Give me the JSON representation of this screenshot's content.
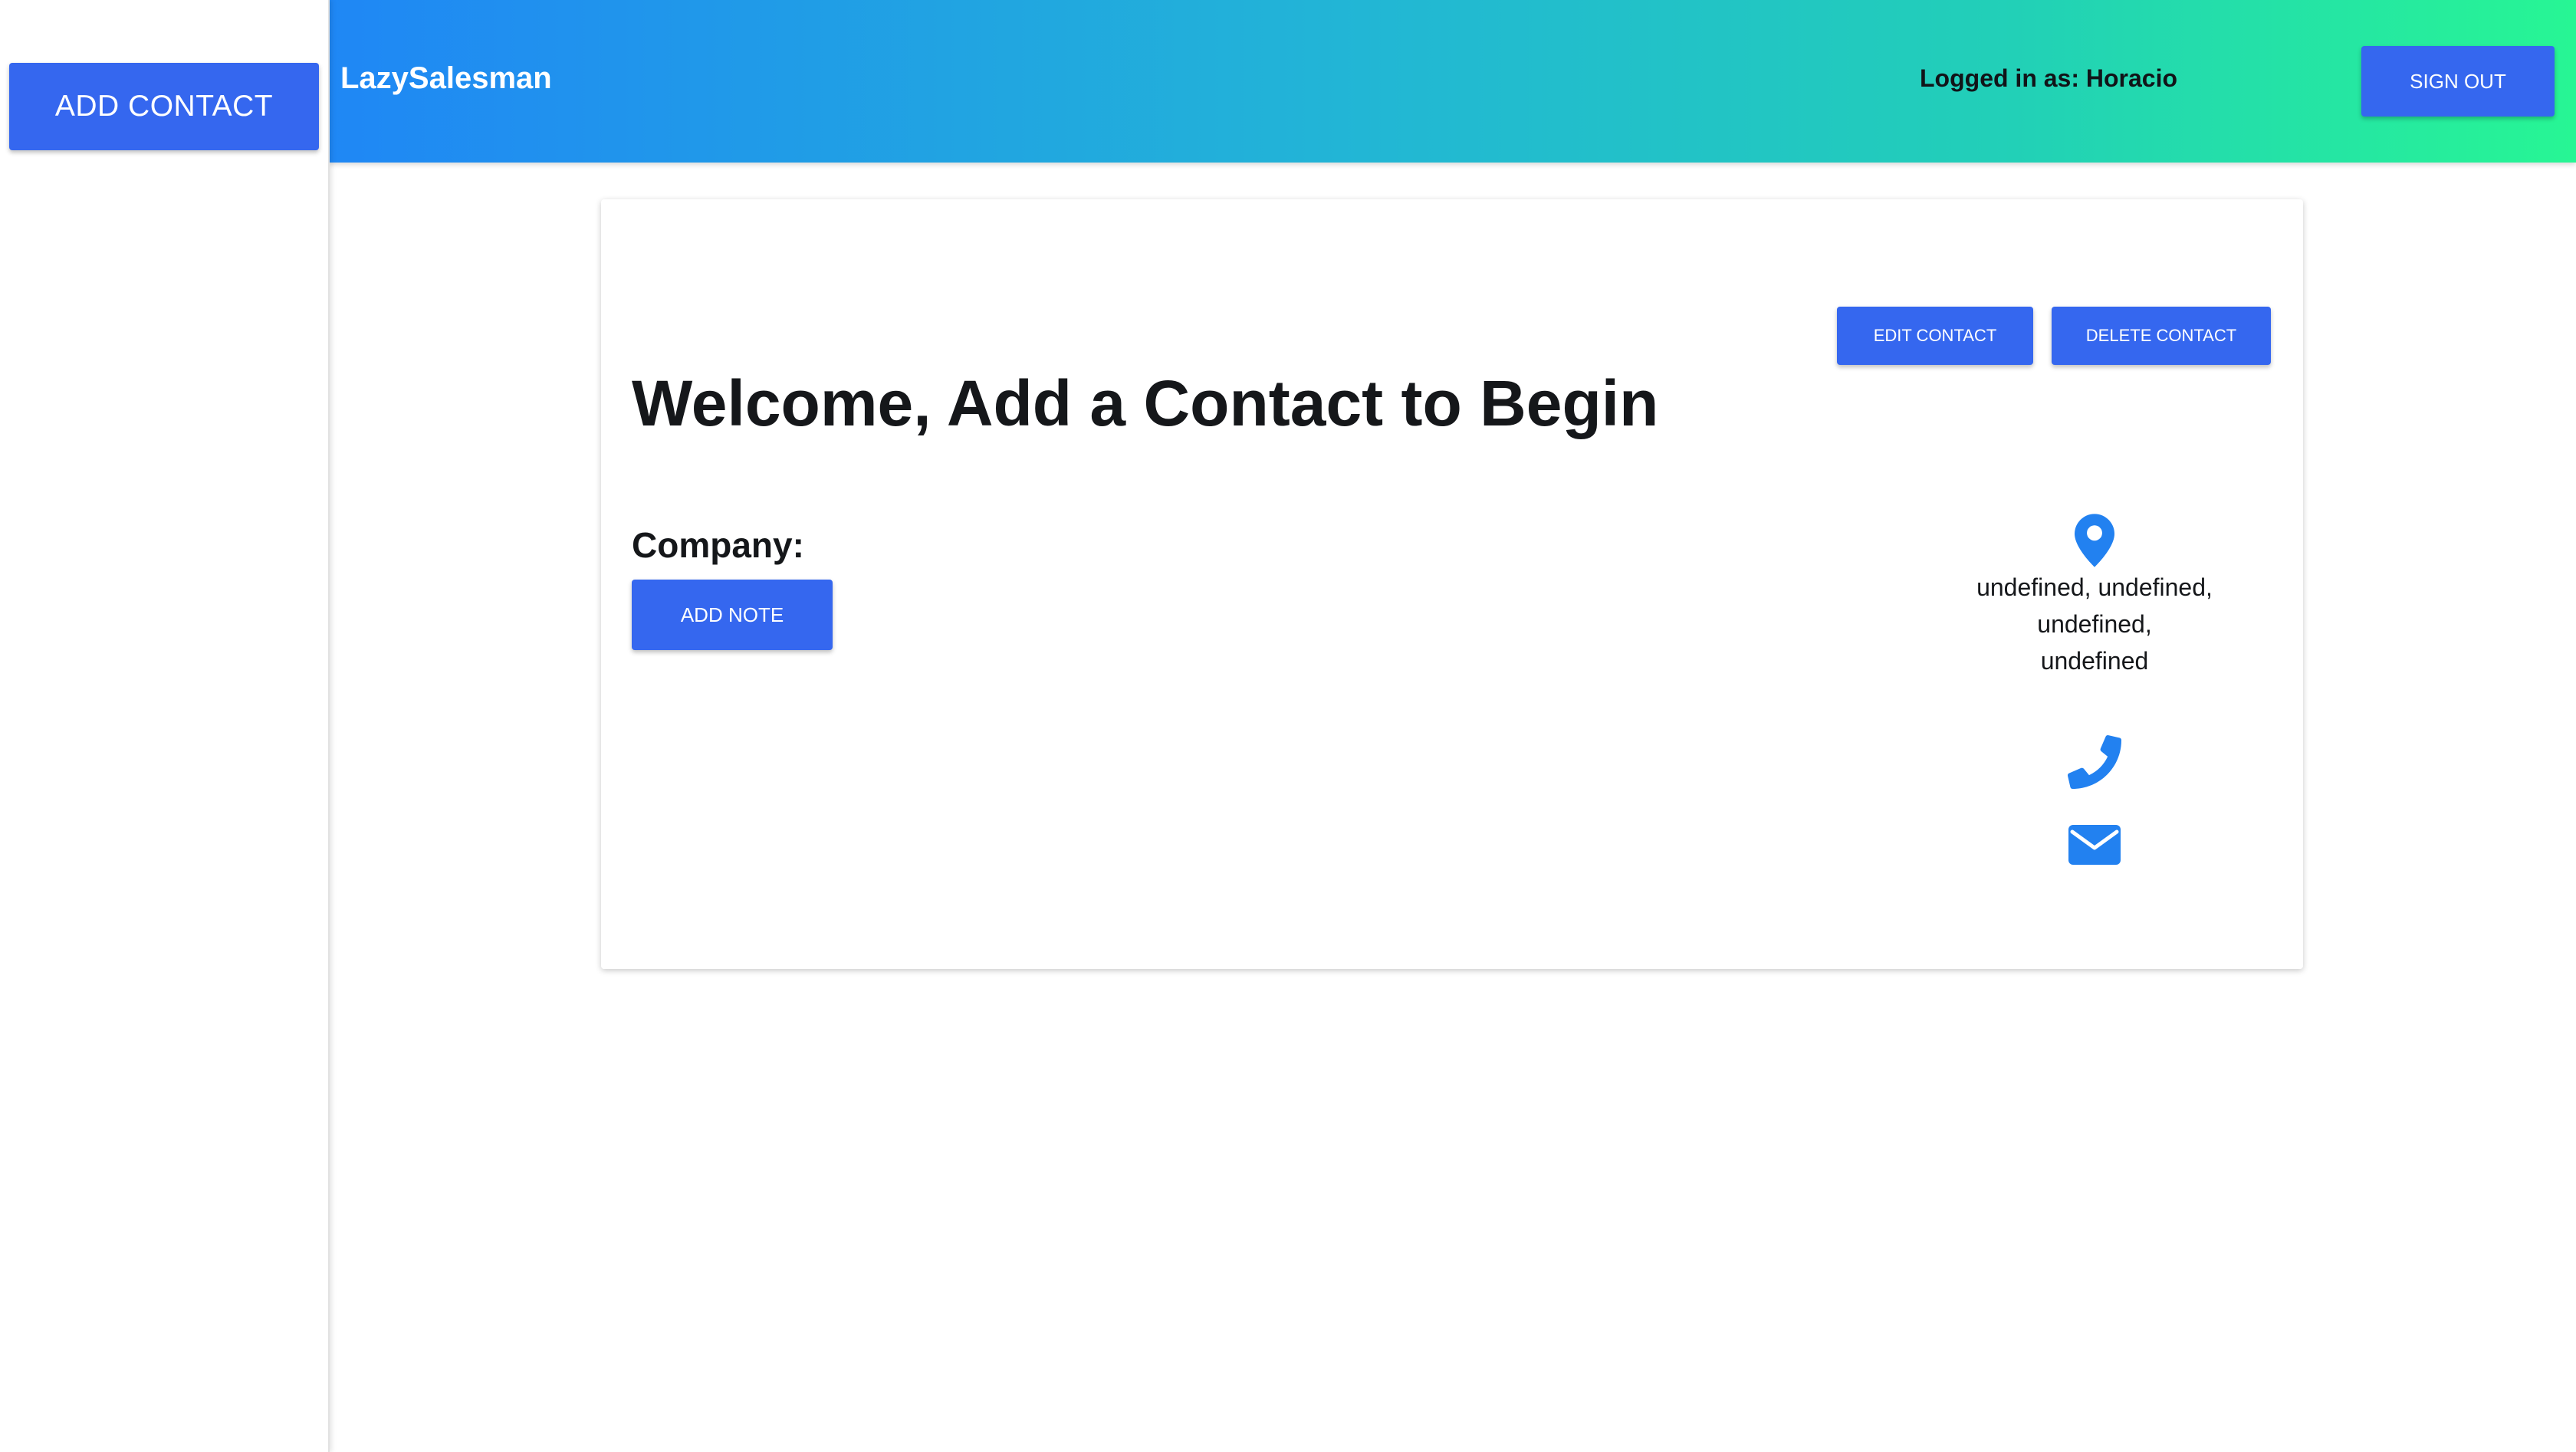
{
  "sidebar": {
    "add_contact_label": "ADD CONTACT"
  },
  "header": {
    "brand": "LazySalesman",
    "logged_in_text": "Logged in as: Horacio",
    "sign_out_label": "SIGN OUT"
  },
  "card": {
    "edit_label": "EDIT CONTACT",
    "delete_label": "DELETE CONTACT",
    "welcome_title": "Welcome, Add a Contact to Begin",
    "company_label": "Company:",
    "add_note_label": "ADD NOTE",
    "address_line1": "undefined, undefined, undefined,",
    "address_line2": "undefined",
    "icons": [
      "map-pin-icon",
      "phone-icon",
      "envelope-icon"
    ]
  },
  "colors": {
    "accent": "#3567ef",
    "icon_blue": "#2281f0",
    "gradient_start": "#1f87f5",
    "gradient_end": "#27f694"
  }
}
